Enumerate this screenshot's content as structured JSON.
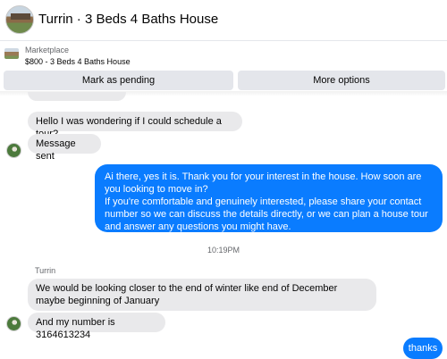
{
  "header": {
    "title": "Turrin · 3 Beds 4 Baths House"
  },
  "listing": {
    "label": "Marketplace",
    "title": "$800 - 3 Beds 4 Baths House"
  },
  "actions": {
    "mark_pending": "Mark as pending",
    "more_options": "More options"
  },
  "messages": {
    "tour": "Hello I was wondering if I could schedule a tour?",
    "sent": "Message sent",
    "ai_line1": "Ai there, yes it is. Thank you for your interest in the house. How soon are you looking to move in?",
    "ai_line2": "If you're comfortable and genuinely interested, please share your contact number so we can discuss the details directly, or we can plan a house tour and answer any questions you might have.",
    "timestamp": "10:19PM",
    "sender": "Turrin",
    "winter": "We would be looking closer to the end of winter like end of December maybe beginning of January",
    "number": "And my number is 3164613234",
    "thanks": "thanks"
  },
  "colors": {
    "outgoing_bubble": "#0a7cff",
    "incoming_bubble": "#e9e9eb",
    "button_bg": "#e4e6eb"
  },
  "icons": {
    "header_avatar": "house-avatar-icon",
    "listing_thumb": "house-thumbnail-icon",
    "contact_avatar": "user-avatar-icon"
  }
}
